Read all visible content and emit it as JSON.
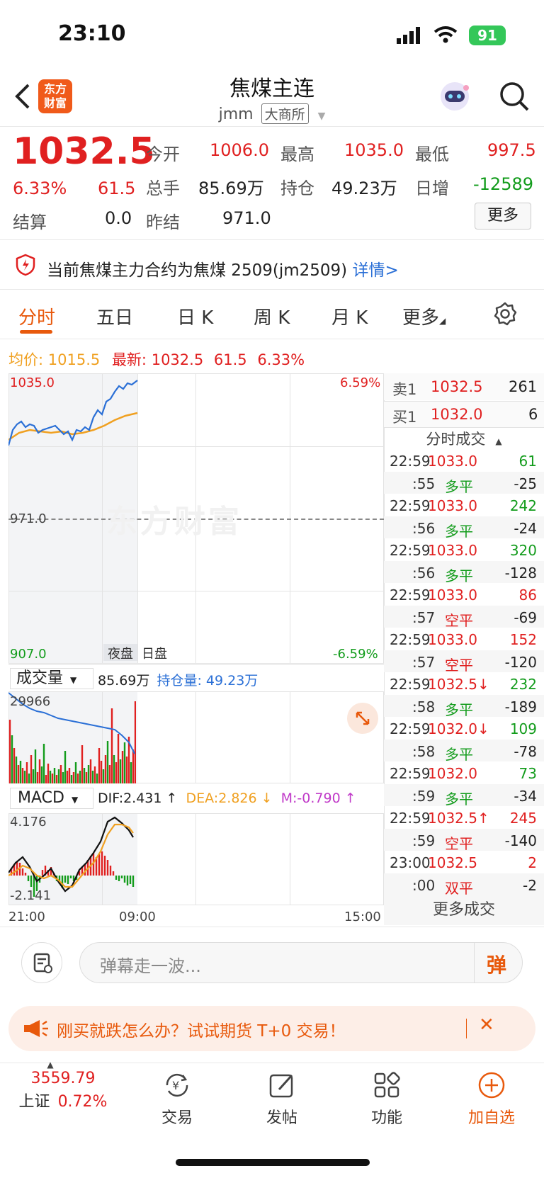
{
  "status_bar": {
    "time": "23:10",
    "battery": "91"
  },
  "header": {
    "title": "焦煤主连",
    "code": "jmm",
    "exchange": "大商所",
    "logo_text_1": "东方",
    "logo_text_2": "财富"
  },
  "quote": {
    "price": "1032.5",
    "pct": "6.33%",
    "change": "61.5",
    "open_label": "今开",
    "open": "1006.0",
    "high_label": "最高",
    "high": "1035.0",
    "low_label": "最低",
    "low": "997.5",
    "volume_label": "总手",
    "volume": "85.69万",
    "oi_label": "持仓",
    "oi": "49.23万",
    "daily_inc_label": "日增",
    "daily_inc": "-12589",
    "settle_label": "结算",
    "settle": "0.0",
    "prev_settle_label": "昨结",
    "prev_settle": "971.0",
    "more": "更多"
  },
  "notice": {
    "text": "当前焦煤主力合约为焦煤 2509(jm2509)",
    "link": "详情"
  },
  "tabs": [
    "分时",
    "五日",
    "日 K",
    "周 K",
    "月 K",
    "更多"
  ],
  "info_line": {
    "avg_label": "均价:",
    "avg": "1015.5",
    "latest_label": "最新:",
    "latest": "1032.5",
    "change": "61.5",
    "pct": "6.33%"
  },
  "chart": {
    "y_top": "1035.0",
    "y_mid": "971.0",
    "y_bottom": "907.0",
    "pct_top": "6.59%",
    "pct_bottom": "-6.59%",
    "night_label": "夜盘",
    "day_label": "日盘",
    "x_start": "21:00",
    "x_mid": "09:00",
    "x_end": "15:00",
    "watermark": "东方财富"
  },
  "volume_panel": {
    "label": "成交量",
    "value": "85.69万",
    "oi_label": "持仓量:",
    "oi_value": "49.23万",
    "y_top": "29966"
  },
  "macd_panel": {
    "label": "MACD",
    "dif": "DIF:2.431 ↑",
    "dea": "DEA:2.826 ↓",
    "m": "M:-0.790 ↑",
    "y_top": "4.176",
    "y_bottom": "-2.141"
  },
  "order_book": {
    "sell1_label": "卖1",
    "sell1_price": "1032.5",
    "sell1_vol": "261",
    "buy1_label": "买1",
    "buy1_price": "1032.0",
    "buy1_vol": "6",
    "header": "分时成交",
    "trades": [
      {
        "t": "22:59",
        "p": "1033.0",
        "v": "61",
        "pc": "red",
        "vc": "green"
      },
      {
        "t": ":55",
        "p": "多平",
        "v": "-25",
        "pc": "green",
        "vc": "dark"
      },
      {
        "t": "22:59",
        "p": "1033.0",
        "v": "242",
        "pc": "red",
        "vc": "green"
      },
      {
        "t": ":56",
        "p": "多平",
        "v": "-24",
        "pc": "green",
        "vc": "dark"
      },
      {
        "t": "22:59",
        "p": "1033.0",
        "v": "320",
        "pc": "red",
        "vc": "green"
      },
      {
        "t": ":56",
        "p": "多平",
        "v": "-128",
        "pc": "green",
        "vc": "dark"
      },
      {
        "t": "22:59",
        "p": "1033.0",
        "v": "86",
        "pc": "red",
        "vc": "red"
      },
      {
        "t": ":57",
        "p": "空平",
        "v": "-69",
        "pc": "red",
        "vc": "dark"
      },
      {
        "t": "22:59",
        "p": "1033.0",
        "v": "152",
        "pc": "red",
        "vc": "red"
      },
      {
        "t": ":57",
        "p": "空平",
        "v": "-120",
        "pc": "red",
        "vc": "dark"
      },
      {
        "t": "22:59",
        "p": "1032.5↓",
        "v": "232",
        "pc": "red",
        "vc": "green"
      },
      {
        "t": ":58",
        "p": "多平",
        "v": "-189",
        "pc": "green",
        "vc": "dark"
      },
      {
        "t": "22:59",
        "p": "1032.0↓",
        "v": "109",
        "pc": "red",
        "vc": "green"
      },
      {
        "t": ":58",
        "p": "多平",
        "v": "-78",
        "pc": "green",
        "vc": "dark"
      },
      {
        "t": "22:59",
        "p": "1032.0",
        "v": "73",
        "pc": "red",
        "vc": "green"
      },
      {
        "t": ":59",
        "p": "多平",
        "v": "-34",
        "pc": "green",
        "vc": "dark"
      },
      {
        "t": "22:59",
        "p": "1032.5↑",
        "v": "245",
        "pc": "red",
        "vc": "red"
      },
      {
        "t": ":59",
        "p": "空平",
        "v": "-140",
        "pc": "red",
        "vc": "dark"
      },
      {
        "t": "23:00",
        "p": "1032.5",
        "v": "2",
        "pc": "red",
        "vc": "red"
      },
      {
        "t": ":00",
        "p": "双平",
        "v": "-2",
        "pc": "red",
        "vc": "dark"
      }
    ],
    "more_trades": "更多成交"
  },
  "comment": {
    "placeholder": "弹幕走一波...",
    "danmu": "弹"
  },
  "promo": {
    "text": "刚买就跌怎么办？试试期货 T+0 交易！"
  },
  "bottom_nav": {
    "index_value": "3559.79",
    "index_name": "上证",
    "index_pct": "0.72%",
    "trade": "交易",
    "post": "发帖",
    "function": "功能",
    "add": "加自选"
  },
  "colors": {
    "up": "#e02020",
    "down": "#139c1c",
    "accent": "#e8590c",
    "price_line": "#2a6fd6",
    "avg_line": "#f0a020"
  }
}
